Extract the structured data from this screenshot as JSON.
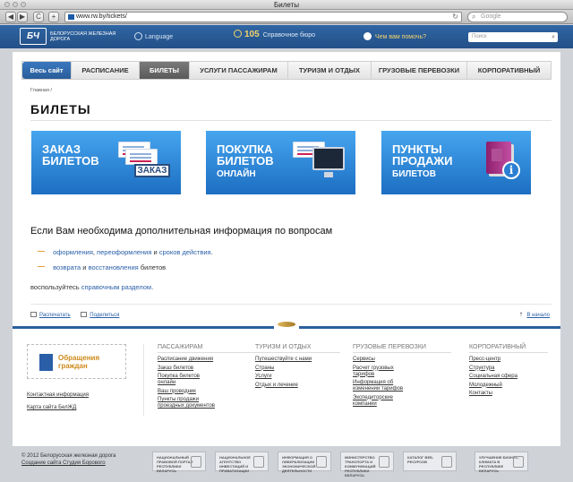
{
  "browser": {
    "title": "Билеты",
    "url": "www.rw.by/tickets/",
    "search_placeholder": "Google",
    "back": "◀",
    "forward": "▶",
    "reload": "C",
    "add": "+",
    "refresh_glyph": "↻"
  },
  "header": {
    "logo_mark": "БЧ",
    "logo_text": "Белорусская железная дорога",
    "language": "Language",
    "phone_number": "105",
    "phone_label": "Справочное бюро",
    "help": "Чем вам помочь?",
    "search_placeholder": "Поиск"
  },
  "nav": {
    "all": "Весь сайт",
    "items": [
      "РАСПИСАНИЕ",
      "БИЛЕТЫ",
      "УСЛУГИ ПАССАЖИРАМ",
      "ТУРИЗМ И ОТДЫХ",
      "ГРУЗОВЫЕ ПЕРЕВОЗКИ",
      "КОРПОРАТИВНЫЙ"
    ]
  },
  "breadcrumb": "Главная /",
  "page_title": "БИЛЕТЫ",
  "banners": [
    {
      "line1": "Заказ",
      "line2": "билетов",
      "line3": "",
      "plate": "ЗАКАЗ"
    },
    {
      "line1": "Покупка",
      "line2": "билетов",
      "line3": "онлайн"
    },
    {
      "line1": "Пункты",
      "line2": "продажи",
      "line3": "билетов",
      "info": "i"
    }
  ],
  "question": "Если Вам необходима дополнительная информация по вопросам",
  "list1": {
    "a1": "оформления",
    "s1": ", ",
    "a2": "переоформления",
    "s2": " и ",
    "a3": "сроков действия",
    "end": "."
  },
  "list2": {
    "a1": "возврата",
    "s1": " и ",
    "a2": "восстановления",
    "end": " билетов"
  },
  "use": {
    "pre": "воспользуйтесь ",
    "link": "справочным разделом",
    "end": "."
  },
  "tools": {
    "print": "Распечатать",
    "share": "Поделиться",
    "top": "В начало",
    "top_arrow": "⇡"
  },
  "appeal": {
    "text": "Обращения\nграждан"
  },
  "footer_links": [
    "Контактная информация",
    "Карта сайта БелЖД"
  ],
  "footer_cols": [
    {
      "title": "Пассажирам",
      "items": [
        "Расписание движения",
        "Заказ билетов",
        "Покупка билетов онлайн",
        "Ваш проводник",
        "Пункты продажи проездных документов"
      ]
    },
    {
      "title": "Туризм и отдых",
      "items": [
        "Путешествуйте с нами",
        "Страны",
        "Услуги",
        "Отдых и лечение"
      ]
    },
    {
      "title": "Грузовые перевозки",
      "items": [
        "Сервисы",
        "Расчет грузовых тарифов",
        "Информация об изменении тарифов",
        "Экспедиторские компании"
      ]
    },
    {
      "title": "Корпоративный",
      "items": [
        "Пресс-центр",
        "Структура",
        "Социальная сфера",
        "Молодежный",
        "Контакты"
      ]
    }
  ],
  "copyright": {
    "line1": "© 2012 Белорусская железная дорога",
    "line2": "Создание сайта Студия Борового"
  },
  "badges": [
    "Национальный правовой портал Республики Беларусь",
    "Национальное агентство инвестиций и приватизации",
    "Информация о либерализации экономической деятельности",
    "Министерство транспорта и коммуникаций Республики Беларусь",
    "Каталог веб-ресурсов",
    "Улучшение бизнес-климата в Республике Беларусь"
  ]
}
